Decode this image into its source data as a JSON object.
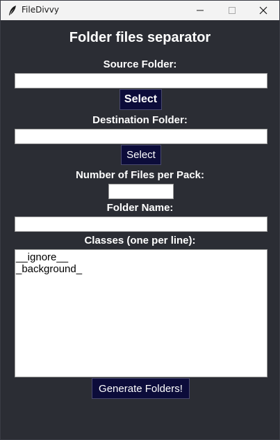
{
  "window": {
    "title": "FileDivvy"
  },
  "main": {
    "heading": "Folder files separator",
    "source_folder": {
      "label": "Source Folder:",
      "value": "",
      "button_label": "Select"
    },
    "destination_folder": {
      "label": "Destination Folder:",
      "value": "",
      "button_label": "Select"
    },
    "files_per_pack": {
      "label": "Number of Files per Pack:",
      "value": ""
    },
    "folder_name": {
      "label": "Folder Name:",
      "value": ""
    },
    "classes": {
      "label": "Classes (one per line):",
      "value": "__ignore__\n_background_"
    },
    "generate_button_label": "Generate Folders!"
  },
  "colors": {
    "window_background": "#2b2d34",
    "titlebar_background": "#f3f3f3",
    "button_background": "#0c0c3a",
    "text": "#ffffff"
  },
  "icons": {
    "app": "feather-icon",
    "minimize": "minimize-icon",
    "maximize": "maximize-icon",
    "close": "close-icon"
  }
}
